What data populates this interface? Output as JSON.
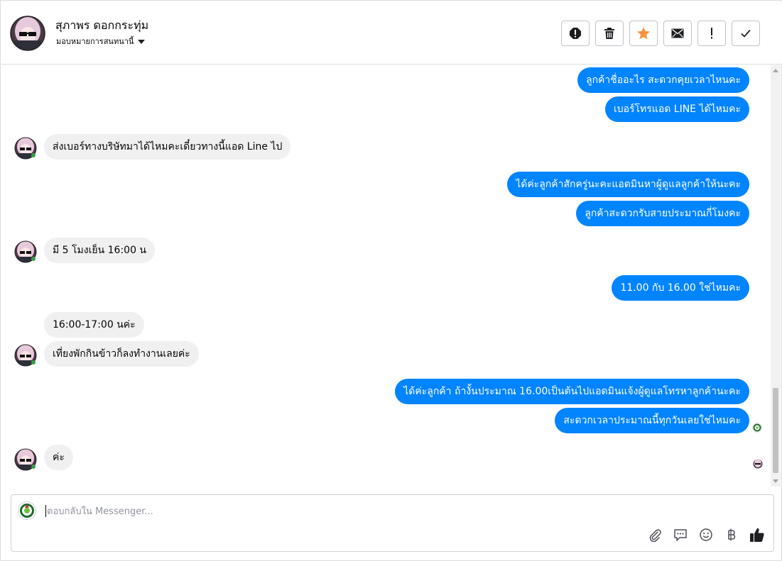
{
  "header": {
    "contact_name": "สุภาพร ดอกกระทุ่ม",
    "assign_label": "มอบหมายการสนทนานี้"
  },
  "toolbar": [
    {
      "name": "spam-button",
      "icon": "alert-circle-icon"
    },
    {
      "name": "delete-button",
      "icon": "trash-icon"
    },
    {
      "name": "star-button",
      "icon": "star-icon",
      "color": "#f7923b"
    },
    {
      "name": "mark-unread-button",
      "icon": "envelope-icon"
    },
    {
      "name": "follow-up-button",
      "icon": "exclamation-icon"
    },
    {
      "name": "mark-done-button",
      "icon": "checkmark-icon"
    }
  ],
  "messages": [
    {
      "dir": "out",
      "text": "ลูกค้าชื่ออะไร สะดวกคุยเวลาไหนคะ"
    },
    {
      "dir": "out",
      "text": "เบอร์โทรแอด LINE ได้ไหมคะ"
    },
    {
      "dir": "in",
      "text": "ส่งเบอร์ทางบริษัทมาได้ไหมคะเดี๋ยวทางนี้แอด Line ไป"
    },
    {
      "dir": "out",
      "text": "ได้ค่ะลูกค้าสักครู่นะคะแอดมินหาผู้ดูแลลูกค้าให้นะคะ"
    },
    {
      "dir": "out",
      "text": "ลูกค้าสะดวกรับสายประมาณกี่โมงคะ"
    },
    {
      "dir": "in",
      "text": "มี 5 โมงเย็น 16:00 น"
    },
    {
      "dir": "out",
      "text": "11.00 กับ 16.00 ใช่ไหมคะ"
    },
    {
      "dir": "in",
      "text": "16:00-17:00 นค่ะ"
    },
    {
      "dir": "in",
      "text": "เที่ยงพักกินข้าวก็ลงทำงานเลยค่ะ"
    },
    {
      "dir": "out",
      "text": "ได้ค่ะลูกค้า ถ้างั้นประมาณ 16.00เป็นต้นไปแอดมินแจ้งผู้ดูแลโทรหาลูกค้านะคะ"
    },
    {
      "dir": "out",
      "text": "สะดวกเวลาประมาณนี้ทุกวันเลยใช่ไหมคะ"
    },
    {
      "dir": "in",
      "text": "ค่ะ"
    }
  ],
  "composer": {
    "placeholder": "ตอบกลับใน Messenger...",
    "tools": [
      "paperclip-icon",
      "chat-bubble-icon",
      "emoji-icon",
      "baht-icon",
      "thumbs-up-icon"
    ]
  },
  "colors": {
    "outgoing_bubble": "#0084ff",
    "incoming_bubble": "#f0f0f0",
    "star": "#f7923b"
  }
}
